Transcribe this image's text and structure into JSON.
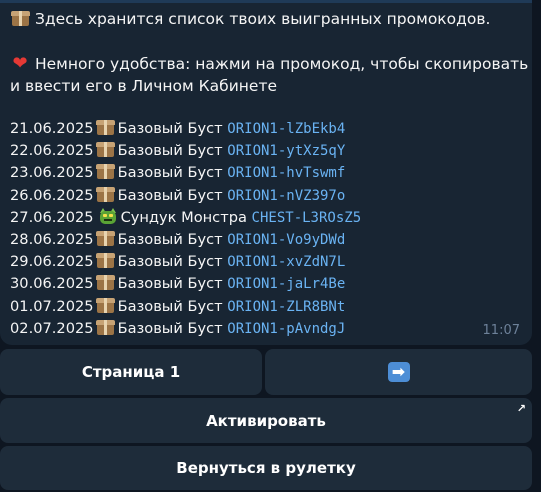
{
  "message": {
    "line1_text": "Здесь хранится список твоих выигранных промокодов.",
    "line1_icon": "package-icon",
    "line2_text": "Немного удобства: нажми на промокод, чтобы скопировать",
    "line2_icon": "heart-icon",
    "line3_text": "и ввести его в Личном Кабинете",
    "promos": [
      {
        "date": "21.06.2025",
        "icon": "box-icon",
        "name": "Базовый Буст",
        "code": "ORION1-lZbEkb4"
      },
      {
        "date": "22.06.2025",
        "icon": "box-icon",
        "name": "Базовый Буст",
        "code": "ORION1-ytXz5qY"
      },
      {
        "date": "23.06.2025",
        "icon": "box-icon",
        "name": "Базовый Буст",
        "code": "ORION1-hvTswmf"
      },
      {
        "date": "26.06.2025",
        "icon": "box-icon",
        "name": "Базовый Буст",
        "code": "ORION1-nVZ397o"
      },
      {
        "date": "27.06.2025",
        "icon": "monster-icon",
        "name": "Сундук Монстра",
        "code": "CHEST-L3ROsZ5"
      },
      {
        "date": "28.06.2025",
        "icon": "box-icon",
        "name": "Базовый Буст",
        "code": "ORION1-Vo9yDWd"
      },
      {
        "date": "29.06.2025",
        "icon": "box-icon",
        "name": "Базовый Буст",
        "code": "ORION1-xvZdN7L"
      },
      {
        "date": "30.06.2025",
        "icon": "box-icon",
        "name": "Базовый Буст",
        "code": "ORION1-jaLr4Be"
      },
      {
        "date": "01.07.2025",
        "icon": "box-icon",
        "name": "Базовый Буст",
        "code": "ORION1-ZLR8BNt"
      },
      {
        "date": "02.07.2025",
        "icon": "box-icon",
        "name": "Базовый Буст",
        "code": "ORION1-pAvndgJ"
      }
    ],
    "time": "11:07"
  },
  "keyboard": {
    "page_label": "Страница 1",
    "next_icon": "right-arrow-icon",
    "next_glyph": "➡",
    "activate_label": "Активировать",
    "activate_link_glyph": "↗",
    "back_label": "Вернуться в рулетку"
  },
  "colors": {
    "background": "#0e1621",
    "bubble": "#182533",
    "button": "#1e2c3a",
    "link": "#6ab3f3",
    "time": "#6d8199"
  }
}
